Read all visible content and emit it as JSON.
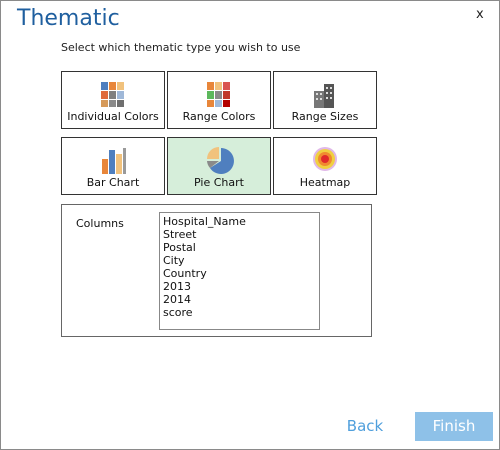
{
  "window": {
    "title": "Thematic",
    "close_label": "x"
  },
  "instruction": "Select which thematic type you wish to use",
  "thematic_types": [
    {
      "label": "Individual Colors",
      "icon": "individual-colors-icon",
      "selected": false
    },
    {
      "label": "Range Colors",
      "icon": "range-colors-icon",
      "selected": false
    },
    {
      "label": "Range Sizes",
      "icon": "range-sizes-icon",
      "selected": false
    },
    {
      "label": "Bar Chart",
      "icon": "bar-chart-icon",
      "selected": false
    },
    {
      "label": "Pie Chart",
      "icon": "pie-chart-icon",
      "selected": true
    },
    {
      "label": "Heatmap",
      "icon": "heatmap-icon",
      "selected": false
    }
  ],
  "columns": {
    "label": "Columns",
    "items": [
      "Hospital_Name",
      "Street",
      "Postal",
      "City",
      "Country",
      "2013",
      "2014",
      "score"
    ]
  },
  "footer": {
    "back_label": "Back",
    "finish_label": "Finish"
  },
  "colors": {
    "title": "#1f5f9f",
    "selected_bg": "#d6eeda",
    "back_text": "#4f9fdc",
    "finish_bg": "#8ec1e8"
  }
}
